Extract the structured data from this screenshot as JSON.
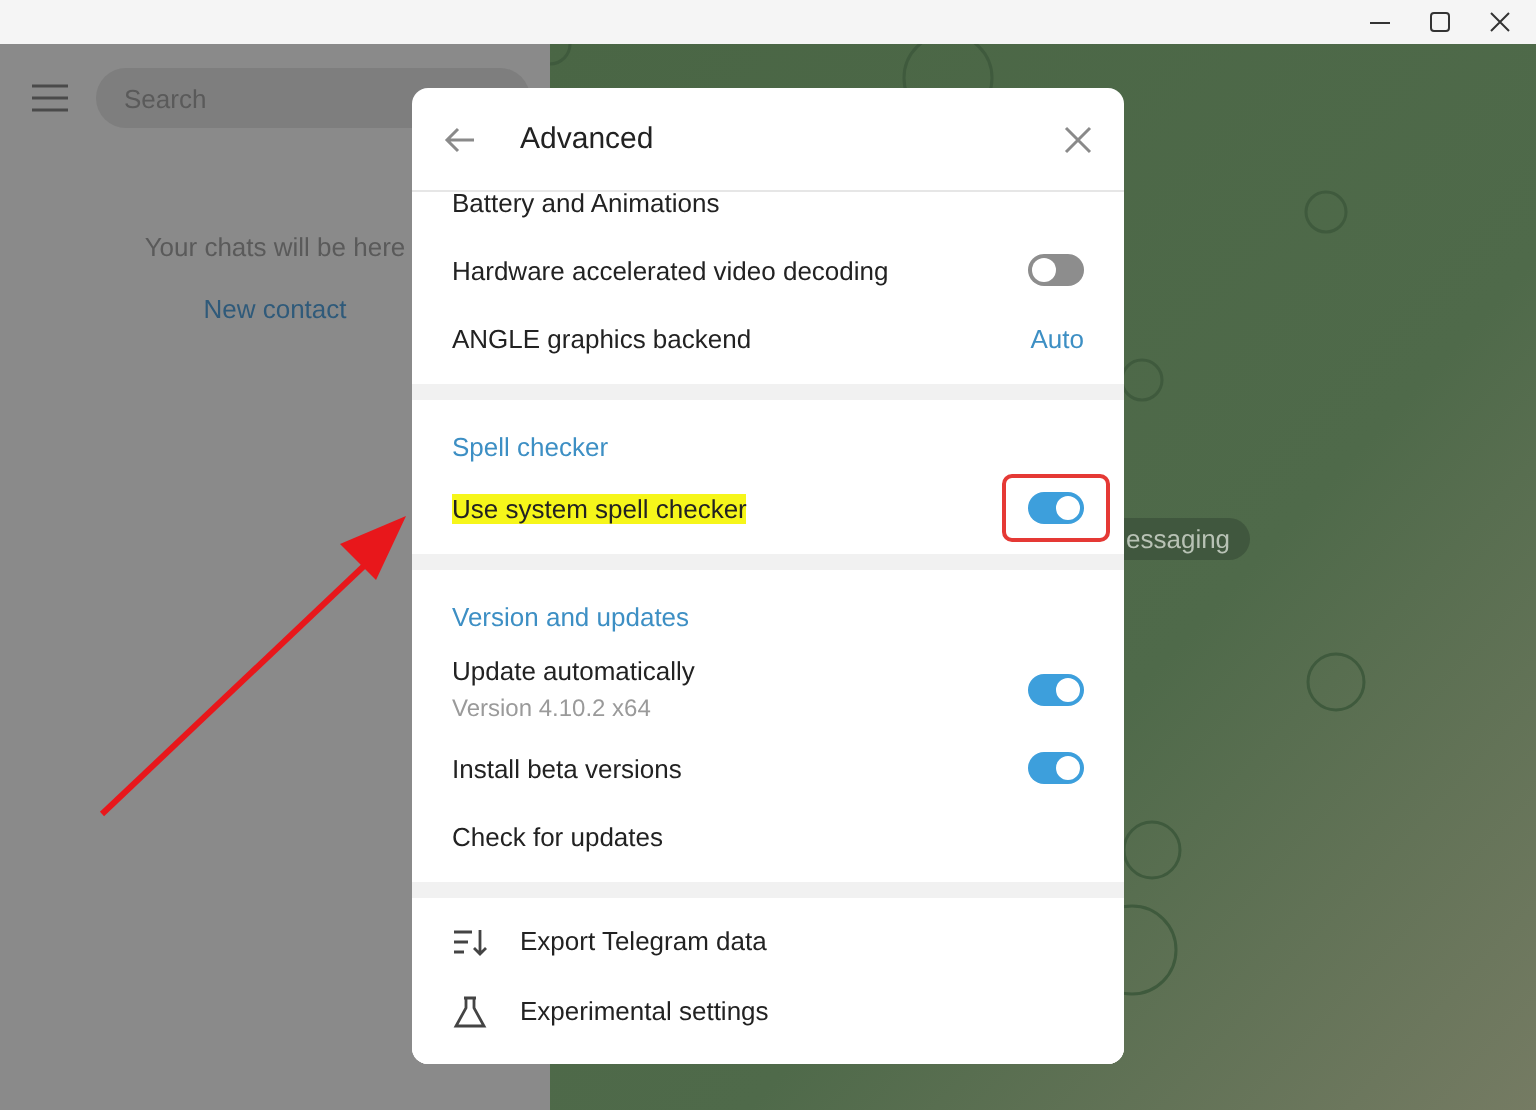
{
  "sidebar": {
    "search": {
      "placeholder": "Search"
    },
    "empty_text": "Your chats will be here",
    "link": "New contact"
  },
  "chat": {
    "pill": "essaging"
  },
  "dialog": {
    "title": "Advanced",
    "sections": [
      {
        "rows": [
          {
            "kind": "label",
            "label": "Battery and Animations"
          },
          {
            "kind": "toggle",
            "label": "Hardware accelerated video decoding",
            "on": false
          },
          {
            "kind": "value",
            "label": "ANGLE graphics backend",
            "value": "Auto"
          }
        ]
      },
      {
        "title": "Spell checker",
        "rows": [
          {
            "kind": "toggle",
            "label": "Use system spell checker",
            "on": true,
            "highlighted": true,
            "boxed": true
          }
        ]
      },
      {
        "title": "Version and updates",
        "rows": [
          {
            "kind": "toggle",
            "label": "Update automatically",
            "sublabel": "Version 4.10.2 x64",
            "on": true
          },
          {
            "kind": "toggle",
            "label": "Install beta versions",
            "on": true
          },
          {
            "kind": "label",
            "label": "Check for updates"
          }
        ]
      },
      {
        "rows": [
          {
            "kind": "icon_link",
            "label": "Export Telegram data"
          },
          {
            "kind": "icon_link",
            "label": "Experimental settings"
          }
        ]
      }
    ]
  },
  "annotation": {
    "arrow": true
  }
}
